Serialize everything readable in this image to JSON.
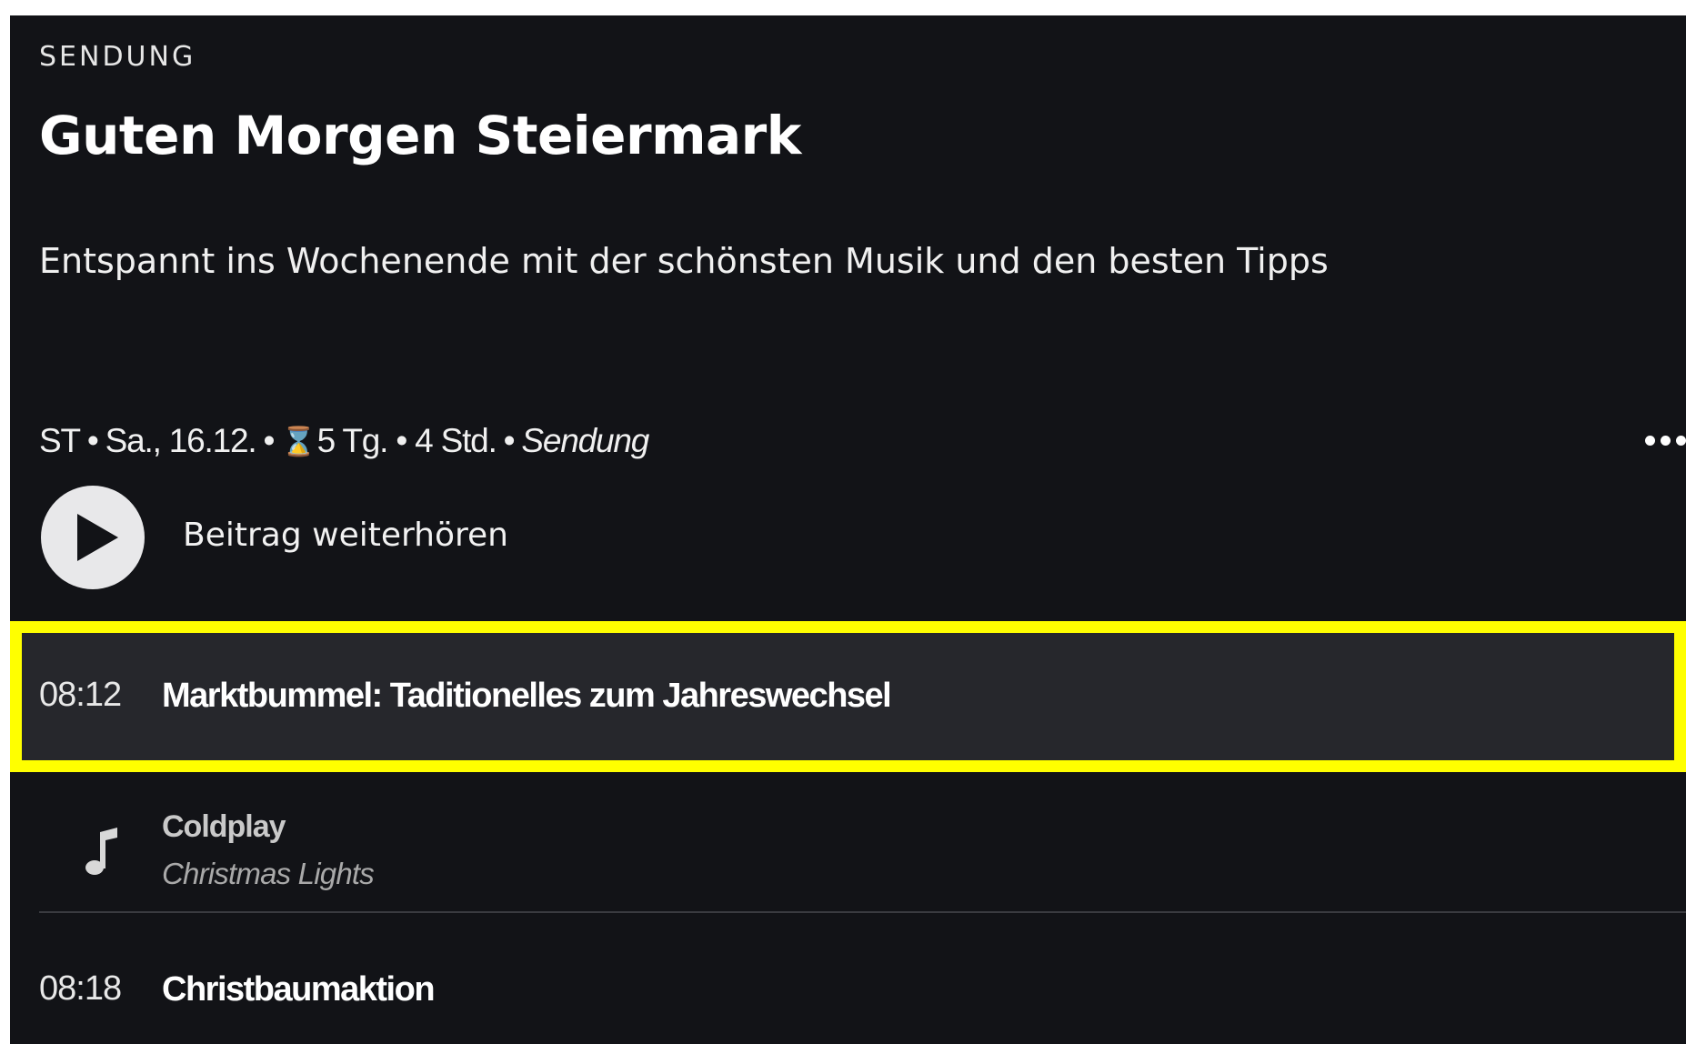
{
  "show": {
    "kicker": "SENDUNG",
    "title": "Guten Morgen Steiermark",
    "description": "Entspannt ins Wochenende mit der schönsten Musik und den besten Tipps"
  },
  "meta": {
    "station": "ST",
    "date": "Sa., 16.12.",
    "availability": "5 Tg. • 4 Std.",
    "type": "Sendung",
    "separator": "•"
  },
  "player": {
    "play_label": "Beitrag weiterhören"
  },
  "items": [
    {
      "time": "08:12",
      "title": "Marktbummel: Taditionelles zum Jahreswechsel"
    },
    {
      "time": "08:18",
      "title": "Christbaumaktion"
    }
  ],
  "song": {
    "artist": "Coldplay",
    "title": "Christmas Lights"
  },
  "icons": {
    "hourglass": "hourglass-icon",
    "more": "more-icon",
    "play": "play-icon",
    "note": "music-note-icon"
  },
  "colors": {
    "background": "#121317",
    "highlight_row": "#26272c",
    "highlight_outline": "#ffff00"
  }
}
